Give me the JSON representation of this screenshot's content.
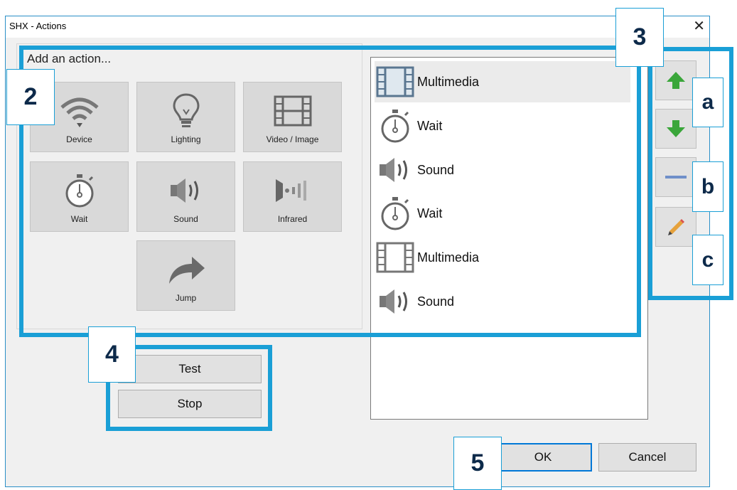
{
  "window": {
    "title": "SHX - Actions",
    "close": "✕"
  },
  "add_group": {
    "title": "Add an action...",
    "tiles": [
      {
        "label": "Device",
        "icon": "wifi-icon"
      },
      {
        "label": "Lighting",
        "icon": "light-bulb-icon"
      },
      {
        "label": "Video / Image",
        "icon": "film-icon"
      },
      {
        "label": "Wait",
        "icon": "stopwatch-icon"
      },
      {
        "label": "Sound",
        "icon": "speaker-icon"
      },
      {
        "label": "Infrared",
        "icon": "infrared-icon"
      },
      {
        "label": "Jump",
        "icon": "jump-arrow-icon"
      }
    ]
  },
  "action_list": {
    "items": [
      {
        "label": "Multimedia",
        "icon": "film-icon",
        "selected": true
      },
      {
        "label": "Wait",
        "icon": "stopwatch-icon"
      },
      {
        "label": "Sound",
        "icon": "speaker-icon"
      },
      {
        "label": "Wait",
        "icon": "stopwatch-icon"
      },
      {
        "label": "Multimedia",
        "icon": "film-icon"
      },
      {
        "label": "Sound",
        "icon": "speaker-icon"
      }
    ]
  },
  "side_buttons": [
    "move-up-icon",
    "move-down-icon",
    "remove-icon",
    "edit-pencil-icon"
  ],
  "test_stop": {
    "test": "Test",
    "stop": "Stop"
  },
  "footer": {
    "ok": "OK",
    "cancel": "Cancel"
  },
  "annotations": {
    "n2": "2",
    "n3": "3",
    "n4": "4",
    "n5": "5",
    "a": "a",
    "b": "b",
    "c": "c"
  },
  "colors": {
    "highlight": "#1a9fd6",
    "label_text": "#0d2a4a",
    "arrow_green": "#3aa63a"
  }
}
